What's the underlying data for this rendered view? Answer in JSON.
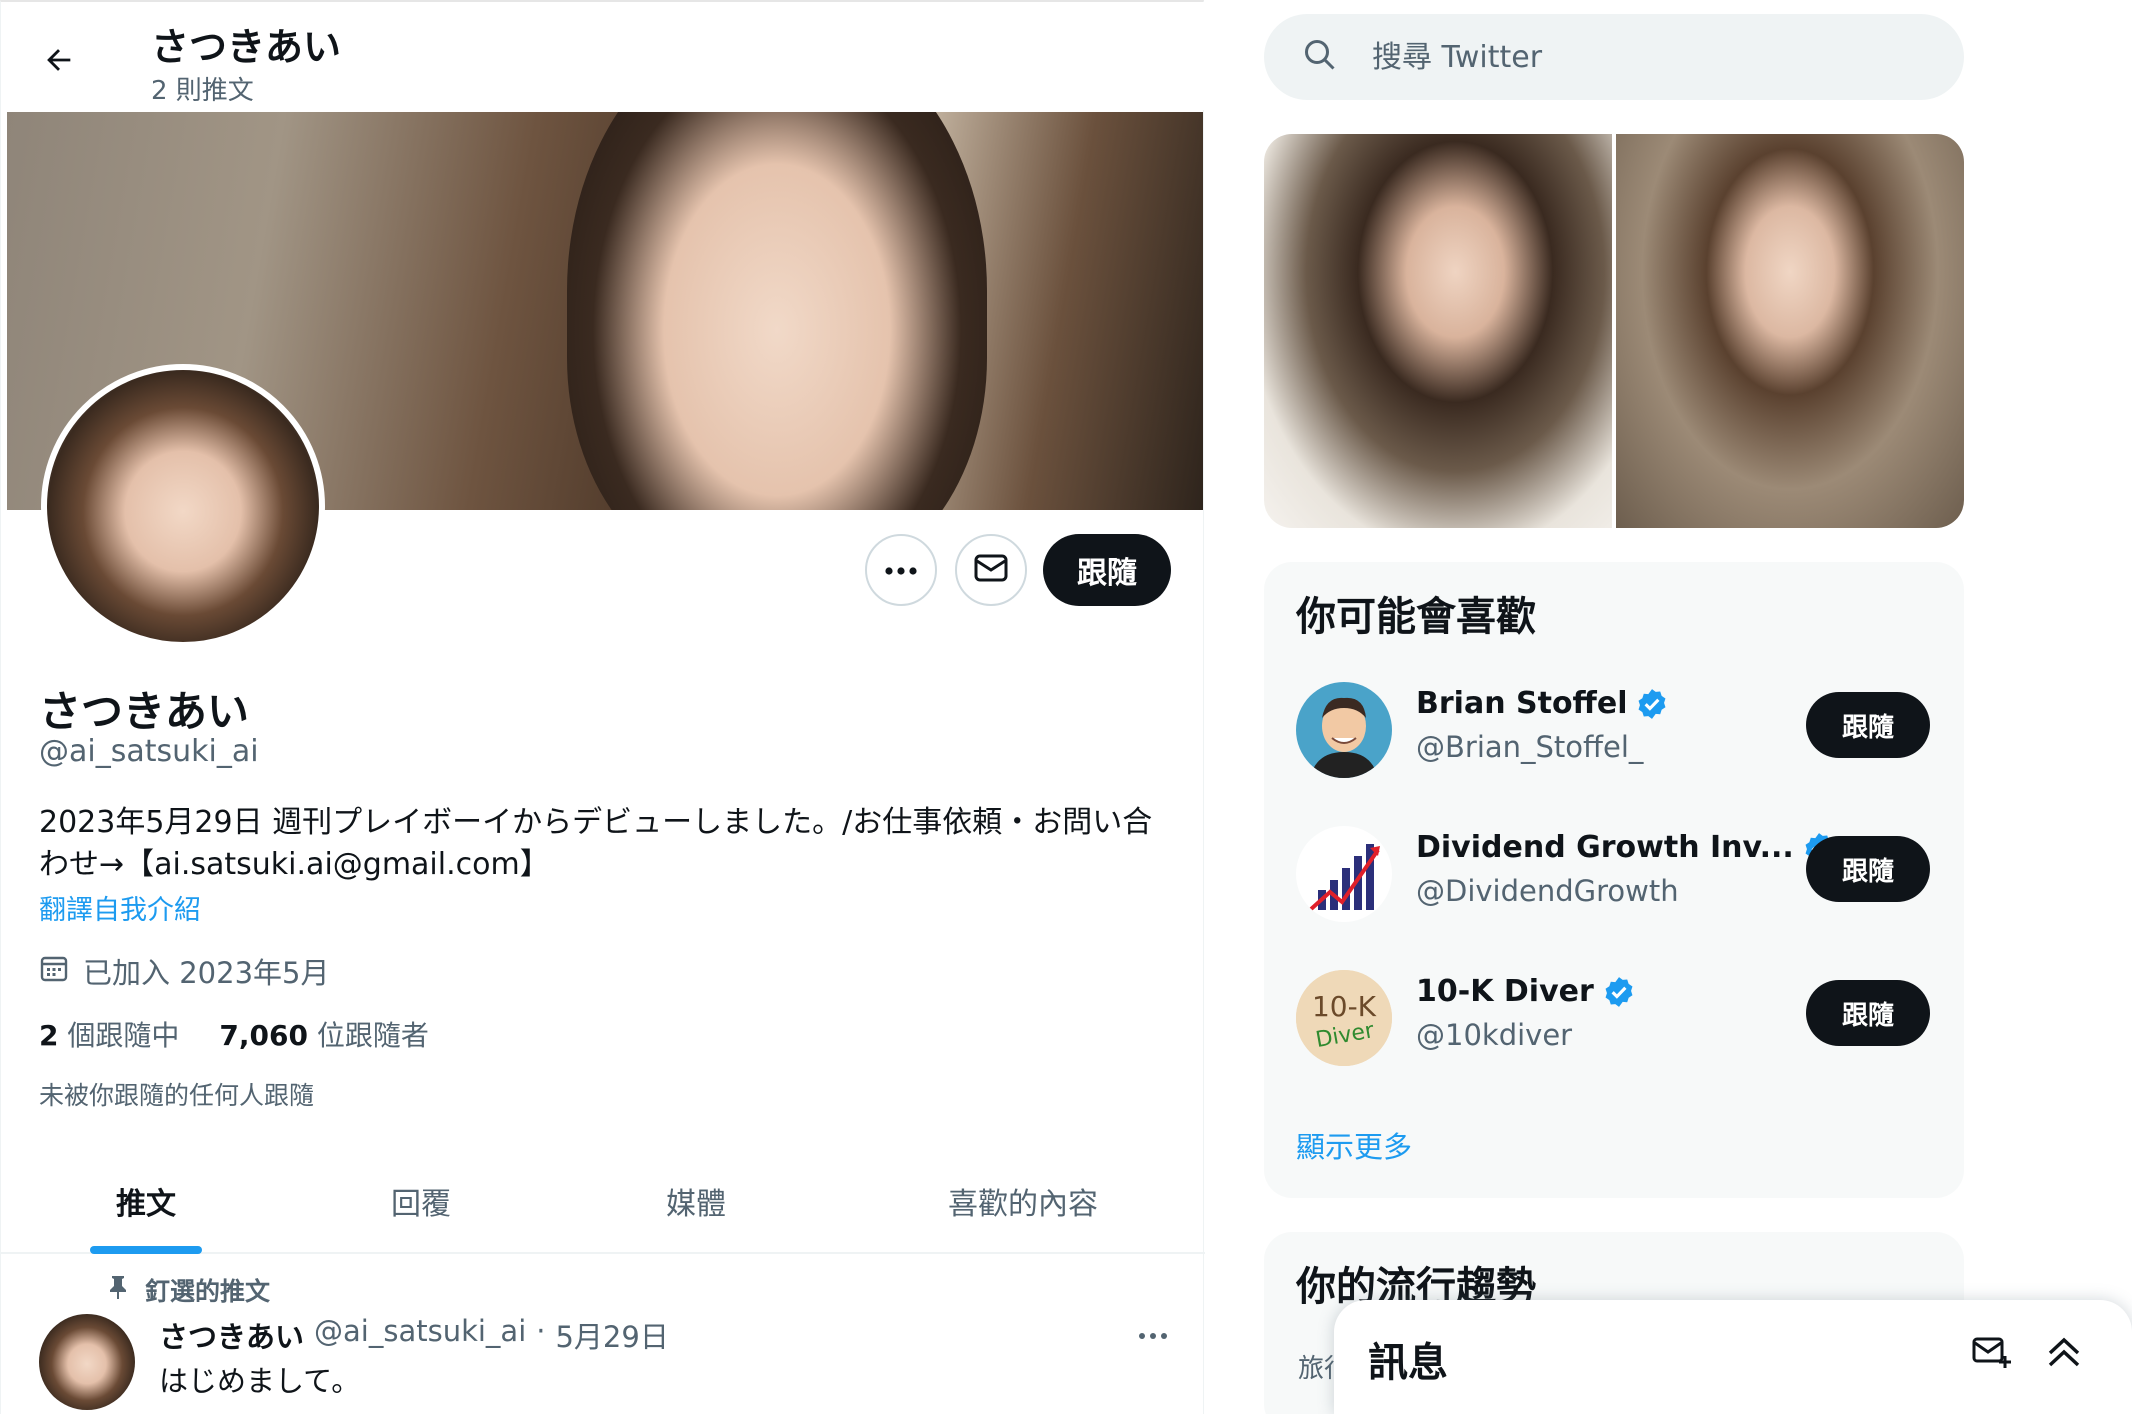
{
  "header": {
    "name": "さつきあい",
    "post_count": "2 則推文"
  },
  "profile": {
    "name": "さつきあい",
    "handle": "@ai_satsuki_ai",
    "follow_label": "跟隨",
    "bio_line1": "2023年5月29日 週刊プレイボーイからデビューしました。/お仕事依頼・お問い合",
    "bio_line2": "わせ→【ai.satsuki.ai@gmail.com】",
    "translate_label": "翻譯自我介紹",
    "joined": "已加入 2023年5月",
    "following_count": "2",
    "following_label": "個跟隨中",
    "followers_count": "7,060",
    "followers_label": "位跟隨者",
    "followed_by_note": "未被你跟隨的任何人跟隨"
  },
  "tabs": [
    {
      "label": "推文",
      "active": true
    },
    {
      "label": "回覆",
      "active": false
    },
    {
      "label": "媒體",
      "active": false
    },
    {
      "label": "喜歡的內容",
      "active": false
    }
  ],
  "pinned_tweet": {
    "pinned_label": "釘選的推文",
    "author_name": "さつきあい",
    "author_handle": "@ai_satsuki_ai",
    "separator": "·",
    "date": "5月29日",
    "text": "はじめまして。"
  },
  "search": {
    "placeholder": "搜尋 Twitter"
  },
  "who_to_follow": {
    "title": "你可能會喜歡",
    "accounts": [
      {
        "name": "Brian Stoffel",
        "handle": "@Brian_Stoffel_",
        "follow_label": "跟隨",
        "verified": true
      },
      {
        "name": "Dividend Growth Inv...",
        "handle": "@DividendGrowth",
        "follow_label": "跟隨",
        "verified": true
      },
      {
        "name": "10-K Diver",
        "handle": "@10kdiver",
        "follow_label": "跟隨",
        "verified": true
      }
    ],
    "show_more": "顯示更多",
    "diver_logo_top": "10-K",
    "diver_logo_bottom": "Diver"
  },
  "trends": {
    "title": "你的流行趨勢",
    "peek": "旅行"
  },
  "messages": {
    "title": "訊息"
  },
  "colors": {
    "accent": "#1d9bf0",
    "text_primary": "#0f1419",
    "text_secondary": "#536471",
    "button_dark": "#0f1419"
  }
}
